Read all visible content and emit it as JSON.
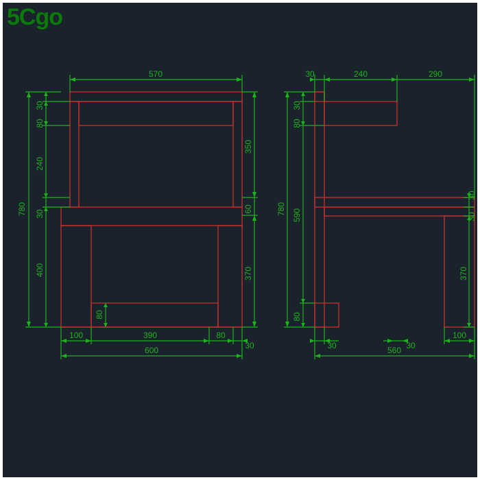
{
  "logo": "5Cgo",
  "views": {
    "front": {
      "description": "Chair front elevation",
      "overall_width": 600,
      "overall_height": 780,
      "backrest_width": 570,
      "dimensions": {
        "top_width": "570",
        "overall_height_left": "780",
        "seg_30_upper": "30",
        "seg_80_upper": "80",
        "seg_240": "240",
        "seg_30_mid": "30",
        "seg_400": "400",
        "overall_width_bottom": "600",
        "leg_left": "100",
        "opening": "390",
        "leg_right": "80",
        "step_30": "30",
        "right_stack_350": "350",
        "right_stack_60": "60",
        "right_stack_370": "370",
        "seg_80_bottom": "80"
      }
    },
    "side": {
      "description": "Chair side elevation",
      "overall_depth": 560,
      "overall_height": 780,
      "dimensions": {
        "top_30": "30",
        "top_240": "240",
        "top_290": "290",
        "left_780": "780",
        "left_30": "30",
        "left_80": "80",
        "left_590": "590",
        "left_80b": "80",
        "right_30a": "30",
        "right_30b": "30",
        "right_370": "370",
        "overall_depth_bottom": "560",
        "leg_100": "100",
        "bottom_30a": "30",
        "bottom_30b": "30"
      }
    }
  }
}
